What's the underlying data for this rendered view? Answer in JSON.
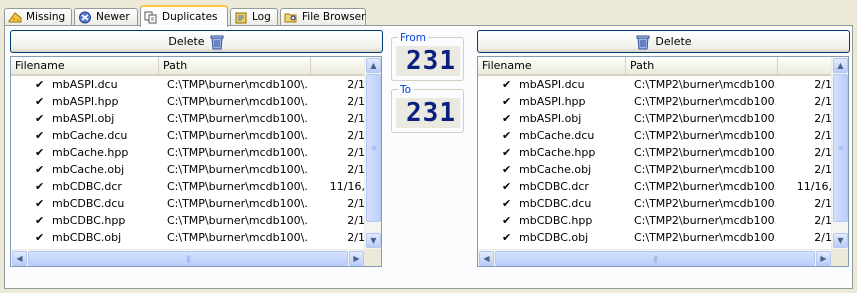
{
  "tabs": [
    {
      "label": "Missing",
      "icon": "cheese-icon"
    },
    {
      "label": "Newer",
      "icon": "newer-icon"
    },
    {
      "label": "Duplicates",
      "icon": "duplicates-icon",
      "active": true
    },
    {
      "label": "Log",
      "icon": "log-icon"
    },
    {
      "label": "File Browser",
      "icon": "folder-search-icon"
    }
  ],
  "left_panel": {
    "delete_label": "Delete",
    "columns": [
      "Filename",
      "Path",
      ""
    ],
    "rows": [
      {
        "filename": "mbASPI.dcu",
        "path": "C:\\TMP\\burner\\mcdb100\\...",
        "date": "2/1"
      },
      {
        "filename": "mbASPI.hpp",
        "path": "C:\\TMP\\burner\\mcdb100\\...",
        "date": "2/1"
      },
      {
        "filename": "mbASPI.obj",
        "path": "C:\\TMP\\burner\\mcdb100\\...",
        "date": "2/1"
      },
      {
        "filename": "mbCache.dcu",
        "path": "C:\\TMP\\burner\\mcdb100\\...",
        "date": "2/1"
      },
      {
        "filename": "mbCache.hpp",
        "path": "C:\\TMP\\burner\\mcdb100\\...",
        "date": "2/1"
      },
      {
        "filename": "mbCache.obj",
        "path": "C:\\TMP\\burner\\mcdb100\\...",
        "date": "2/1"
      },
      {
        "filename": "mbCDBC.dcr",
        "path": "C:\\TMP\\burner\\mcdb100\\...",
        "date": "11/16,"
      },
      {
        "filename": "mbCDBC.dcu",
        "path": "C:\\TMP\\burner\\mcdb100\\...",
        "date": "2/1"
      },
      {
        "filename": "mbCDBC.hpp",
        "path": "C:\\TMP\\burner\\mcdb100\\...",
        "date": "2/1"
      },
      {
        "filename": "mbCDBC.obj",
        "path": "C:\\TMP\\burner\\mcdb100\\...",
        "date": "2/1"
      }
    ]
  },
  "right_panel": {
    "delete_label": "Delete",
    "columns": [
      "Filename",
      "Path",
      ""
    ],
    "rows": [
      {
        "filename": "mbASPI.dcu",
        "path": "C:\\TMP2\\burner\\mcdb100...",
        "date": "2/1"
      },
      {
        "filename": "mbASPI.hpp",
        "path": "C:\\TMP2\\burner\\mcdb100...",
        "date": "2/1"
      },
      {
        "filename": "mbASPI.obj",
        "path": "C:\\TMP2\\burner\\mcdb100...",
        "date": "2/1"
      },
      {
        "filename": "mbCache.dcu",
        "path": "C:\\TMP2\\burner\\mcdb100...",
        "date": "2/1"
      },
      {
        "filename": "mbCache.hpp",
        "path": "C:\\TMP2\\burner\\mcdb100...",
        "date": "2/1"
      },
      {
        "filename": "mbCache.obj",
        "path": "C:\\TMP2\\burner\\mcdb100...",
        "date": "2/1"
      },
      {
        "filename": "mbCDBC.dcr",
        "path": "C:\\TMP2\\burner\\mcdb100...",
        "date": "11/16,"
      },
      {
        "filename": "mbCDBC.dcu",
        "path": "C:\\TMP2\\burner\\mcdb100...",
        "date": "2/1"
      },
      {
        "filename": "mbCDBC.hpp",
        "path": "C:\\TMP2\\burner\\mcdb100...",
        "date": "2/1"
      },
      {
        "filename": "mbCDBC.obj",
        "path": "C:\\TMP2\\burner\\mcdb100...",
        "date": "2/1"
      }
    ]
  },
  "counters": {
    "from_label": "From",
    "from_value": "231",
    "to_label": "To",
    "to_value": "231"
  },
  "colors": {
    "tab_active_accent": "#ffc83c",
    "lcd_digits": "#0a1f80",
    "group_label": "#0046d5"
  }
}
